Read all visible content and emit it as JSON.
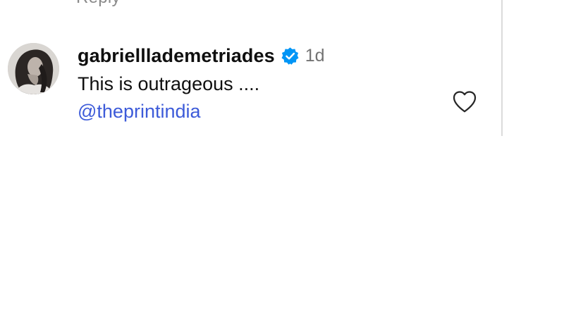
{
  "previous_comment": {
    "partial_text": "Reply"
  },
  "comment": {
    "username": "gabrielllademetriades",
    "verified_icon": "verified-badge-icon",
    "timestamp": "1d",
    "text": "This is outrageous ....",
    "mention": "@theprintindia",
    "like_icon": "heart-outline-icon"
  },
  "colors": {
    "mention": "#3d5bd9",
    "verified_badge": "#0095f6",
    "timestamp": "#737373",
    "divider": "#dbdbdb"
  }
}
